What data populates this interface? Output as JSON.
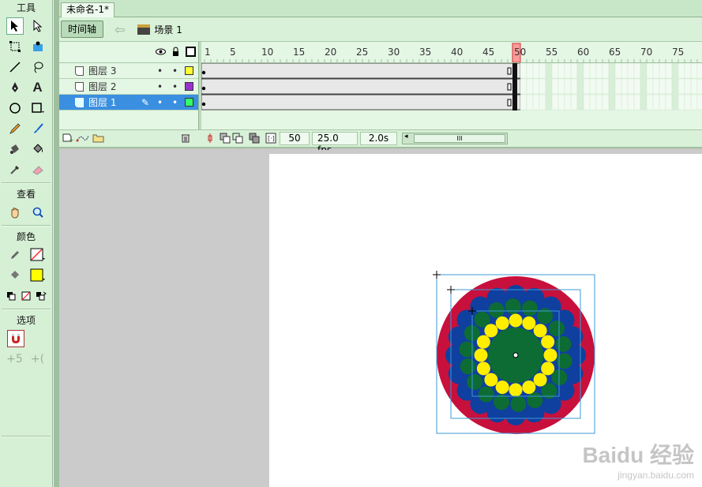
{
  "tools": {
    "title": "工具",
    "view_title": "查看",
    "color_title": "颜色",
    "options_title": "选项",
    "stroke_color": "#ff2a2a",
    "fill_color": "#ffff00"
  },
  "document": {
    "tab_label": "未命名-1*",
    "timeline_button": "时间轴",
    "scene_label": "场景 1"
  },
  "timeline": {
    "ruler_labels": [
      "1",
      "5",
      "10",
      "15",
      "20",
      "25",
      "30",
      "35",
      "40",
      "45",
      "50",
      "55",
      "60",
      "65",
      "70",
      "75"
    ],
    "current_frame_label": "50",
    "layers": [
      {
        "name": "图层 3",
        "color": "#ffff33",
        "selected": false
      },
      {
        "name": "图层 2",
        "color": "#9933cc",
        "selected": false
      },
      {
        "name": "图层 1",
        "color": "#33ff66",
        "selected": true
      }
    ],
    "frame": "50",
    "fps": "25.0 fps",
    "time": "2.0s",
    "scroll_thumb_text": "III"
  },
  "stage": {
    "colors": {
      "outer": "#c8103c",
      "blue": "#0f3f9f",
      "green": "#0d6c34",
      "yellow": "#ffee00"
    },
    "watermark_main": "Baidu 经验",
    "watermark_sub": "jingyan.baidu.com"
  }
}
